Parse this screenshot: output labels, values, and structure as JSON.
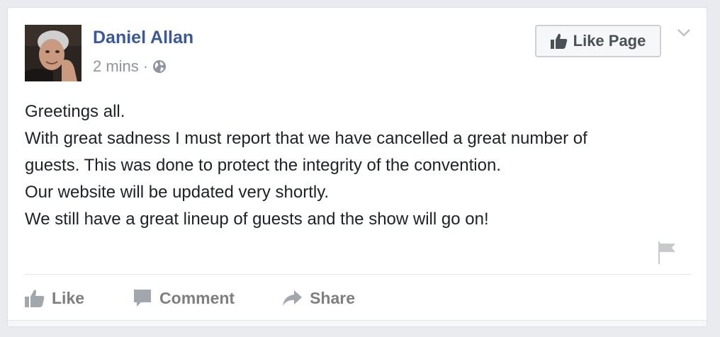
{
  "post": {
    "author": "Daniel Allan",
    "time": "2 mins",
    "separator": "·",
    "privacy_icon": "globe-icon",
    "like_page_label": "Like Page",
    "menu_icon": "chevron-down-icon",
    "lines": [
      "Greetings all.",
      "With great sadness I must report that we have cancelled a great number of",
      "guests. This was done to protect the integrity of the convention.",
      "Our website will be updated very shortly.",
      "We still have a great lineup of guests and the show will go on!"
    ],
    "report_icon": "flag-icon"
  },
  "actions": {
    "like": "Like",
    "comment": "Comment",
    "share": "Share"
  },
  "colors": {
    "author_link": "#3b5998",
    "meta_gray": "#90949c",
    "action_gray": "#7f7f7f",
    "text": "#1d2129"
  }
}
